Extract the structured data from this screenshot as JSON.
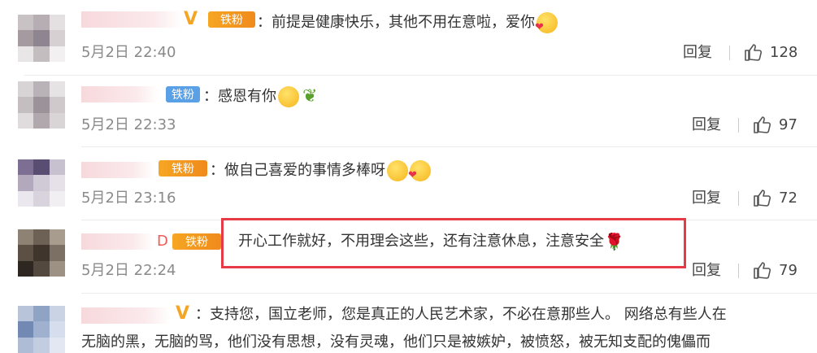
{
  "comments": [
    {
      "text": "：前提是健康快乐，其他不用在意啦，爱你",
      "badge": "铁粉",
      "time": "5月2日 22:40",
      "reply": "回复",
      "likes": "128"
    },
    {
      "text": "：感恩有你",
      "badge": "铁粉",
      "time": "5月2日 22:33",
      "reply": "回复",
      "likes": "97"
    },
    {
      "text": "：做自己喜爱的事情多棒呀",
      "badge": "铁粉",
      "time": "5月2日 23:16",
      "reply": "回复",
      "likes": "72"
    },
    {
      "text": "开心工作就好，不用理会这些，还有注意休息，注意安全",
      "badge": "铁粉",
      "time": "5月2日 22:24",
      "reply": "回复",
      "likes": "79",
      "name_tail": "D"
    },
    {
      "text": "：支持您，国立老师，您是真正的人民艺术家，不必在意那些人。 网络总有些人在",
      "text2": "无脑的黑，无脑的骂，他们没有思想，没有灵魂，他们只是被嫉妒，被愤怒，被无知支配的傀儡而"
    }
  ],
  "colors": {
    "accent_red": "#e63b46",
    "badge_orange": "#f08a1c",
    "badge_blue": "#5aa0e6"
  }
}
